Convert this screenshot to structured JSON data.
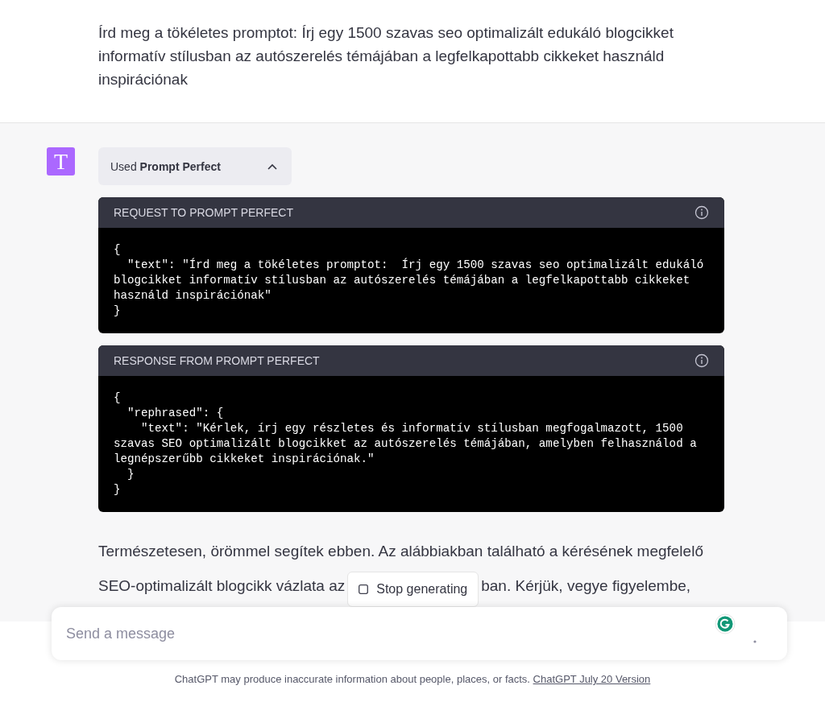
{
  "user_message": {
    "text": "Írd meg a tökéletes promptot:  Írj egy 1500 szavas seo optimalizált edukáló blogcikket informatív stílusban az autószerelés témájában a legfelkapottabb cikkeket használd inspirációnak"
  },
  "assistant": {
    "avatar_letter": "T",
    "plugin_toggle": {
      "prefix": "Used",
      "name": "Prompt Perfect",
      "expanded": true
    },
    "panels": [
      {
        "title": "REQUEST TO PROMPT PERFECT",
        "code": "{\n  \"text\": \"Írd meg a tökéletes promptot:  Írj egy 1500 szavas seo optimalizált edukáló\nblogcikket informatív stílusban az autószerelés témájában a legfelkapottabb cikkeket\nhasználd inspirációnak\"\n}"
      },
      {
        "title": "RESPONSE FROM PROMPT PERFECT",
        "code": "{\n  \"rephrased\": {\n    \"text\": \"Kérlek, írj egy részletes és informatív stílusban megfogalmazott, 1500\nszavas SEO optimalizált blogcikket az autószerelés témájában, amelyben felhasználod a\nlegnépszerűbb cikkeket inspirációnak.\"\n  }\n}"
      }
    ],
    "reply_lines": [
      {
        "parts": [
          "Természetesen, örömmel segítek ebben. Az alábbiakban található a kérésének megfelelő"
        ]
      },
      {
        "parts": [
          "SEO-optimalizált blogcikk vázlata az",
          "ban. Kérjük, vegye figyelembe,"
        ]
      }
    ]
  },
  "stop_button": {
    "label": "Stop generating"
  },
  "composer": {
    "placeholder": "Send a message"
  },
  "footer": {
    "text": "ChatGPT may produce inaccurate information about people, places, or facts.",
    "link": "ChatGPT July 20 Version"
  }
}
